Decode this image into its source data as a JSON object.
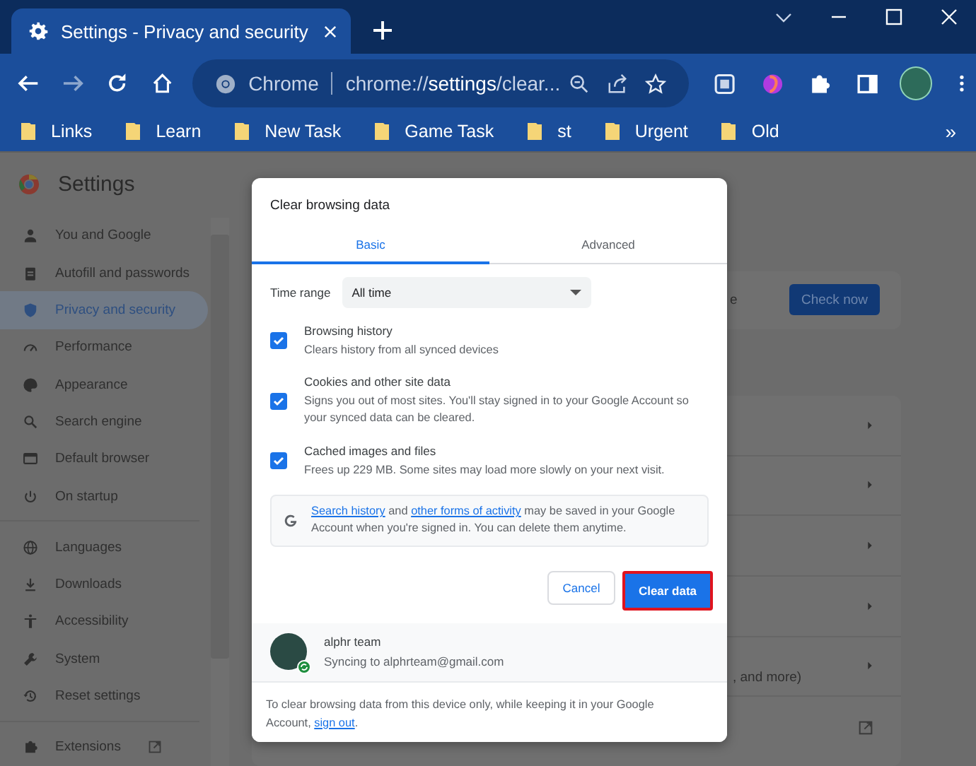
{
  "window": {
    "tab_title": "Settings - Privacy and security"
  },
  "toolbar": {
    "forward_disabled": true,
    "site_label": "Chrome",
    "url": "chrome://**settings**/clear..."
  },
  "bookmarks": {
    "items": [
      "Links",
      "Learn",
      "New Task",
      "Game Task",
      "st",
      "Urgent",
      "Old"
    ],
    "more": "»"
  },
  "settings": {
    "title": "Settings",
    "nav_sections": [
      [
        {
          "label": "You and Google",
          "selected": false
        },
        {
          "label": "Autofill and passwords",
          "selected": false
        },
        {
          "label": "Privacy and security",
          "selected": true
        },
        {
          "label": "Performance",
          "selected": false
        },
        {
          "label": "Appearance",
          "selected": false
        },
        {
          "label": "Search engine",
          "selected": false
        },
        {
          "label": "Default browser",
          "selected": false
        },
        {
          "label": "On startup",
          "selected": false
        }
      ],
      [
        {
          "label": "Languages",
          "selected": false
        },
        {
          "label": "Downloads",
          "selected": false
        },
        {
          "label": "Accessibility",
          "selected": false
        },
        {
          "label": "System",
          "selected": false
        },
        {
          "label": "Reset settings",
          "selected": false
        }
      ],
      [
        {
          "label": "Extensions",
          "selected": false
        }
      ]
    ],
    "safety_fragment": "e",
    "check_now": "Check now",
    "row_fragment": ", and more)"
  },
  "dialog": {
    "title": "Clear browsing data",
    "tabs": [
      {
        "label": "Basic",
        "selected": true
      },
      {
        "label": "Advanced",
        "selected": false
      }
    ],
    "time_range_label": "Time range",
    "time_range_value": "All time",
    "options": [
      {
        "title": "Browsing history",
        "description": "Clears history from all synced devices",
        "checked": true
      },
      {
        "title": "Cookies and other site data",
        "description": "Signs you out of most sites. You'll stay signed in to your Google Account so your synced data can be cleared.",
        "checked": true
      },
      {
        "title": "Cached images and files",
        "description": "Frees up 229 MB. Some sites may load more slowly on your next visit.",
        "checked": true
      }
    ],
    "note": [
      {
        "text": "Search history",
        "kind": "link"
      },
      {
        "text": " and ",
        "kind": "text"
      },
      {
        "text": "other forms of activity",
        "kind": "link"
      },
      {
        "text": " may be saved in your Google Account when you're signed in. You can delete them anytime.",
        "kind": "text"
      }
    ],
    "cancel": "Cancel",
    "clear": {
      "label": "Clear data",
      "highlighted": true
    },
    "account": {
      "name": "alphr team",
      "status": "Syncing to alphrteam@gmail.com"
    },
    "footer": [
      {
        "text": "To clear browsing data from this device only, while keeping it in your Google Account, ",
        "kind": "text"
      },
      {
        "text": "sign out",
        "kind": "link"
      },
      {
        "text": ".",
        "kind": "text"
      }
    ]
  }
}
